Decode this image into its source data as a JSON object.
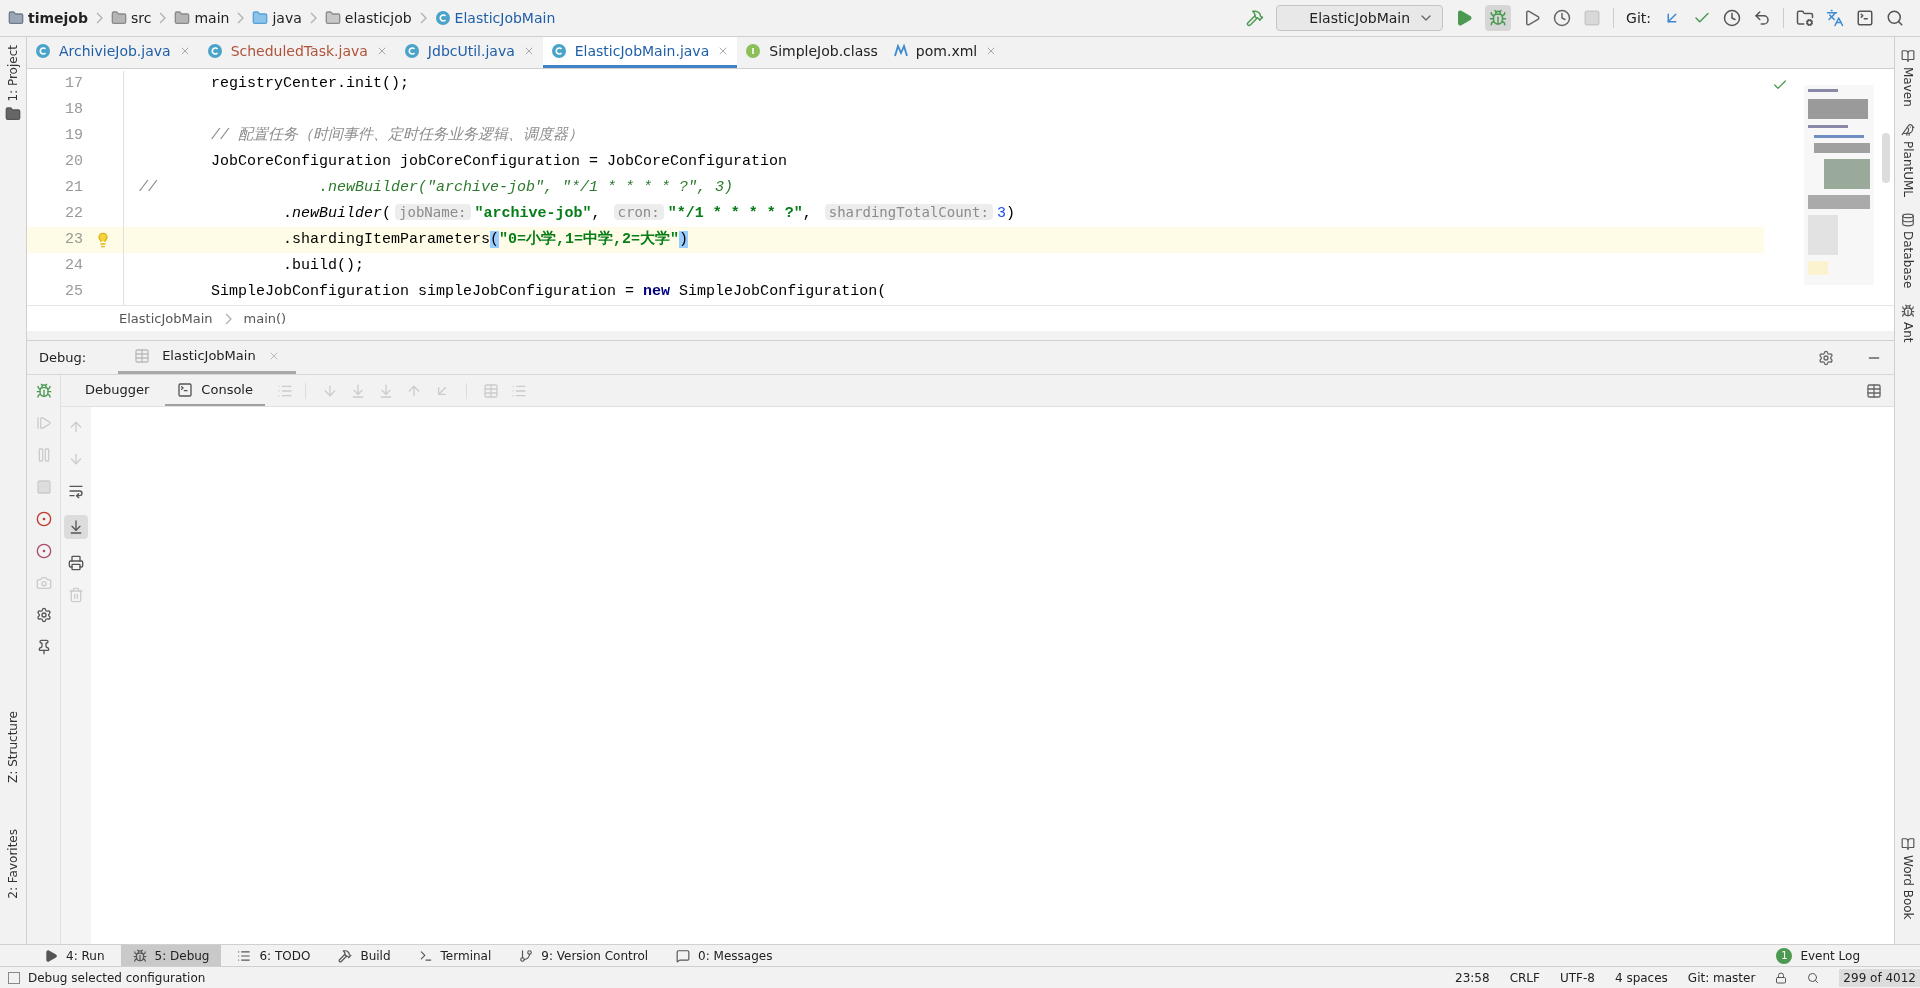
{
  "nav_path": [
    {
      "label": "timejob",
      "kind": "project"
    },
    {
      "label": "src",
      "kind": "folder"
    },
    {
      "label": "main",
      "kind": "folder"
    },
    {
      "label": "java",
      "kind": "source"
    },
    {
      "label": "elasticjob",
      "kind": "package"
    },
    {
      "label": "ElasticJobMain",
      "kind": "class"
    }
  ],
  "toolbar": {
    "run_config": "ElasticJobMain",
    "git_label": "Git:"
  },
  "left_tool_windows_top": [
    "1: Project"
  ],
  "left_tool_windows_bottom": [
    "Z: Structure",
    "2: Favorites"
  ],
  "editor_tabs": [
    {
      "label": "ArchivieJob.java",
      "kind": "class",
      "color": "#1f5fa8",
      "selected": false,
      "closable": true
    },
    {
      "label": "ScheduledTask.java",
      "kind": "class",
      "color": "#b0523a",
      "selected": false,
      "closable": true
    },
    {
      "label": "JdbcUtil.java",
      "kind": "class",
      "color": "#1f5fa8",
      "selected": false,
      "closable": true
    },
    {
      "label": "ElasticJobMain.java",
      "kind": "class",
      "color": "#1f5fa8",
      "selected": true,
      "closable": true
    },
    {
      "label": "SimpleJob.class",
      "kind": "interface",
      "color": "#222222",
      "selected": false,
      "closable": false
    },
    {
      "label": "pom.xml",
      "kind": "maven",
      "color": "#222222",
      "selected": false,
      "closable": true
    }
  ],
  "code_lines": [
    {
      "number": "17",
      "current": false,
      "tokens": [
        {
          "text": "        registryCenter.init();",
          "kind": "plain"
        }
      ]
    },
    {
      "number": "18",
      "current": false
    },
    {
      "number": "19",
      "current": false,
      "tokens": [
        {
          "text": "        // 配置任务（时间事件、定时任务业务逻辑、调度器）",
          "kind": "comment"
        }
      ]
    },
    {
      "number": "20",
      "current": false,
      "tokens": [
        {
          "text": "        JobCoreConfiguration jobCoreConfiguration = JobCoreConfiguration",
          "kind": "plain"
        }
      ]
    },
    {
      "number": "21",
      "current": false,
      "tokens": [
        {
          "text": "//",
          "kind": "comment"
        },
        {
          "text": "                  .newBuilder(\"archive-job\", \"*/1 * * * * ?\", 3)",
          "kind": "commented_code"
        }
      ]
    },
    {
      "number": "22",
      "current": false,
      "tokens": [
        {
          "text": "                .",
          "kind": "plain"
        },
        {
          "text": "newBuilder",
          "kind": "static_method"
        },
        {
          "text": "(",
          "kind": "plain"
        },
        {
          "text": "jobName:",
          "kind": "hint"
        },
        {
          "text": "\"archive-job\"",
          "kind": "string"
        },
        {
          "text": ", ",
          "kind": "plain"
        },
        {
          "text": "cron:",
          "kind": "hint"
        },
        {
          "text": "\"*/1 * * * * ?\"",
          "kind": "string"
        },
        {
          "text": ", ",
          "kind": "plain"
        },
        {
          "text": "shardingTotalCount:",
          "kind": "hint"
        },
        {
          "text": "3",
          "kind": "number"
        },
        {
          "text": ")",
          "kind": "plain"
        }
      ]
    },
    {
      "number": "23",
      "current": true,
      "tokens": [
        {
          "text": "                .shardingItemParameters",
          "kind": "plain"
        },
        {
          "text": "(",
          "kind": "brace_match"
        },
        {
          "text": "\"0=小学,1=中学,2=大学\"",
          "kind": "string"
        },
        {
          "text": ")",
          "kind": "brace_match"
        }
      ]
    },
    {
      "number": "24",
      "current": false,
      "tokens": [
        {
          "text": "                .build();",
          "kind": "plain"
        }
      ]
    },
    {
      "number": "25",
      "current": false,
      "tokens": [
        {
          "text": "        SimpleJobConfiguration simpleJobConfiguration = ",
          "kind": "plain"
        },
        {
          "text": "new",
          "kind": "keyword"
        },
        {
          "text": " SimpleJobConfiguration(",
          "kind": "plain"
        }
      ]
    }
  ],
  "editor_breadcrumbs": [
    "ElasticJobMain",
    "main()"
  ],
  "debug": {
    "title": "Debug:",
    "session_tab": "ElasticJobMain",
    "tabs": [
      {
        "label": "Debugger",
        "selected": false
      },
      {
        "label": "Console",
        "selected": true
      }
    ]
  },
  "right_tool_windows_top": [
    "Maven",
    "PlantUML",
    "Database",
    "Ant"
  ],
  "right_tool_windows_bottom": [
    "Word Book"
  ],
  "bottom_tools": [
    {
      "label": "4: Run",
      "kind": "run",
      "selected": false
    },
    {
      "label": "5: Debug",
      "kind": "debug",
      "selected": true
    },
    {
      "label": "6: TODO",
      "kind": "todo",
      "selected": false
    },
    {
      "label": "Build",
      "kind": "build",
      "selected": false
    },
    {
      "label": "Terminal",
      "kind": "terminal",
      "selected": false
    },
    {
      "label": "9: Version Control",
      "kind": "vcs",
      "selected": false
    },
    {
      "label": "0: Messages",
      "kind": "messages",
      "selected": false
    }
  ],
  "event_log": {
    "label": "Event Log",
    "count": "1"
  },
  "status_bar": {
    "message": "Debug selected configuration",
    "items": [
      "23:58",
      "CRLF",
      "UTF-8",
      "4 spaces",
      "Git: master"
    ],
    "memory": "299 of 4012"
  }
}
